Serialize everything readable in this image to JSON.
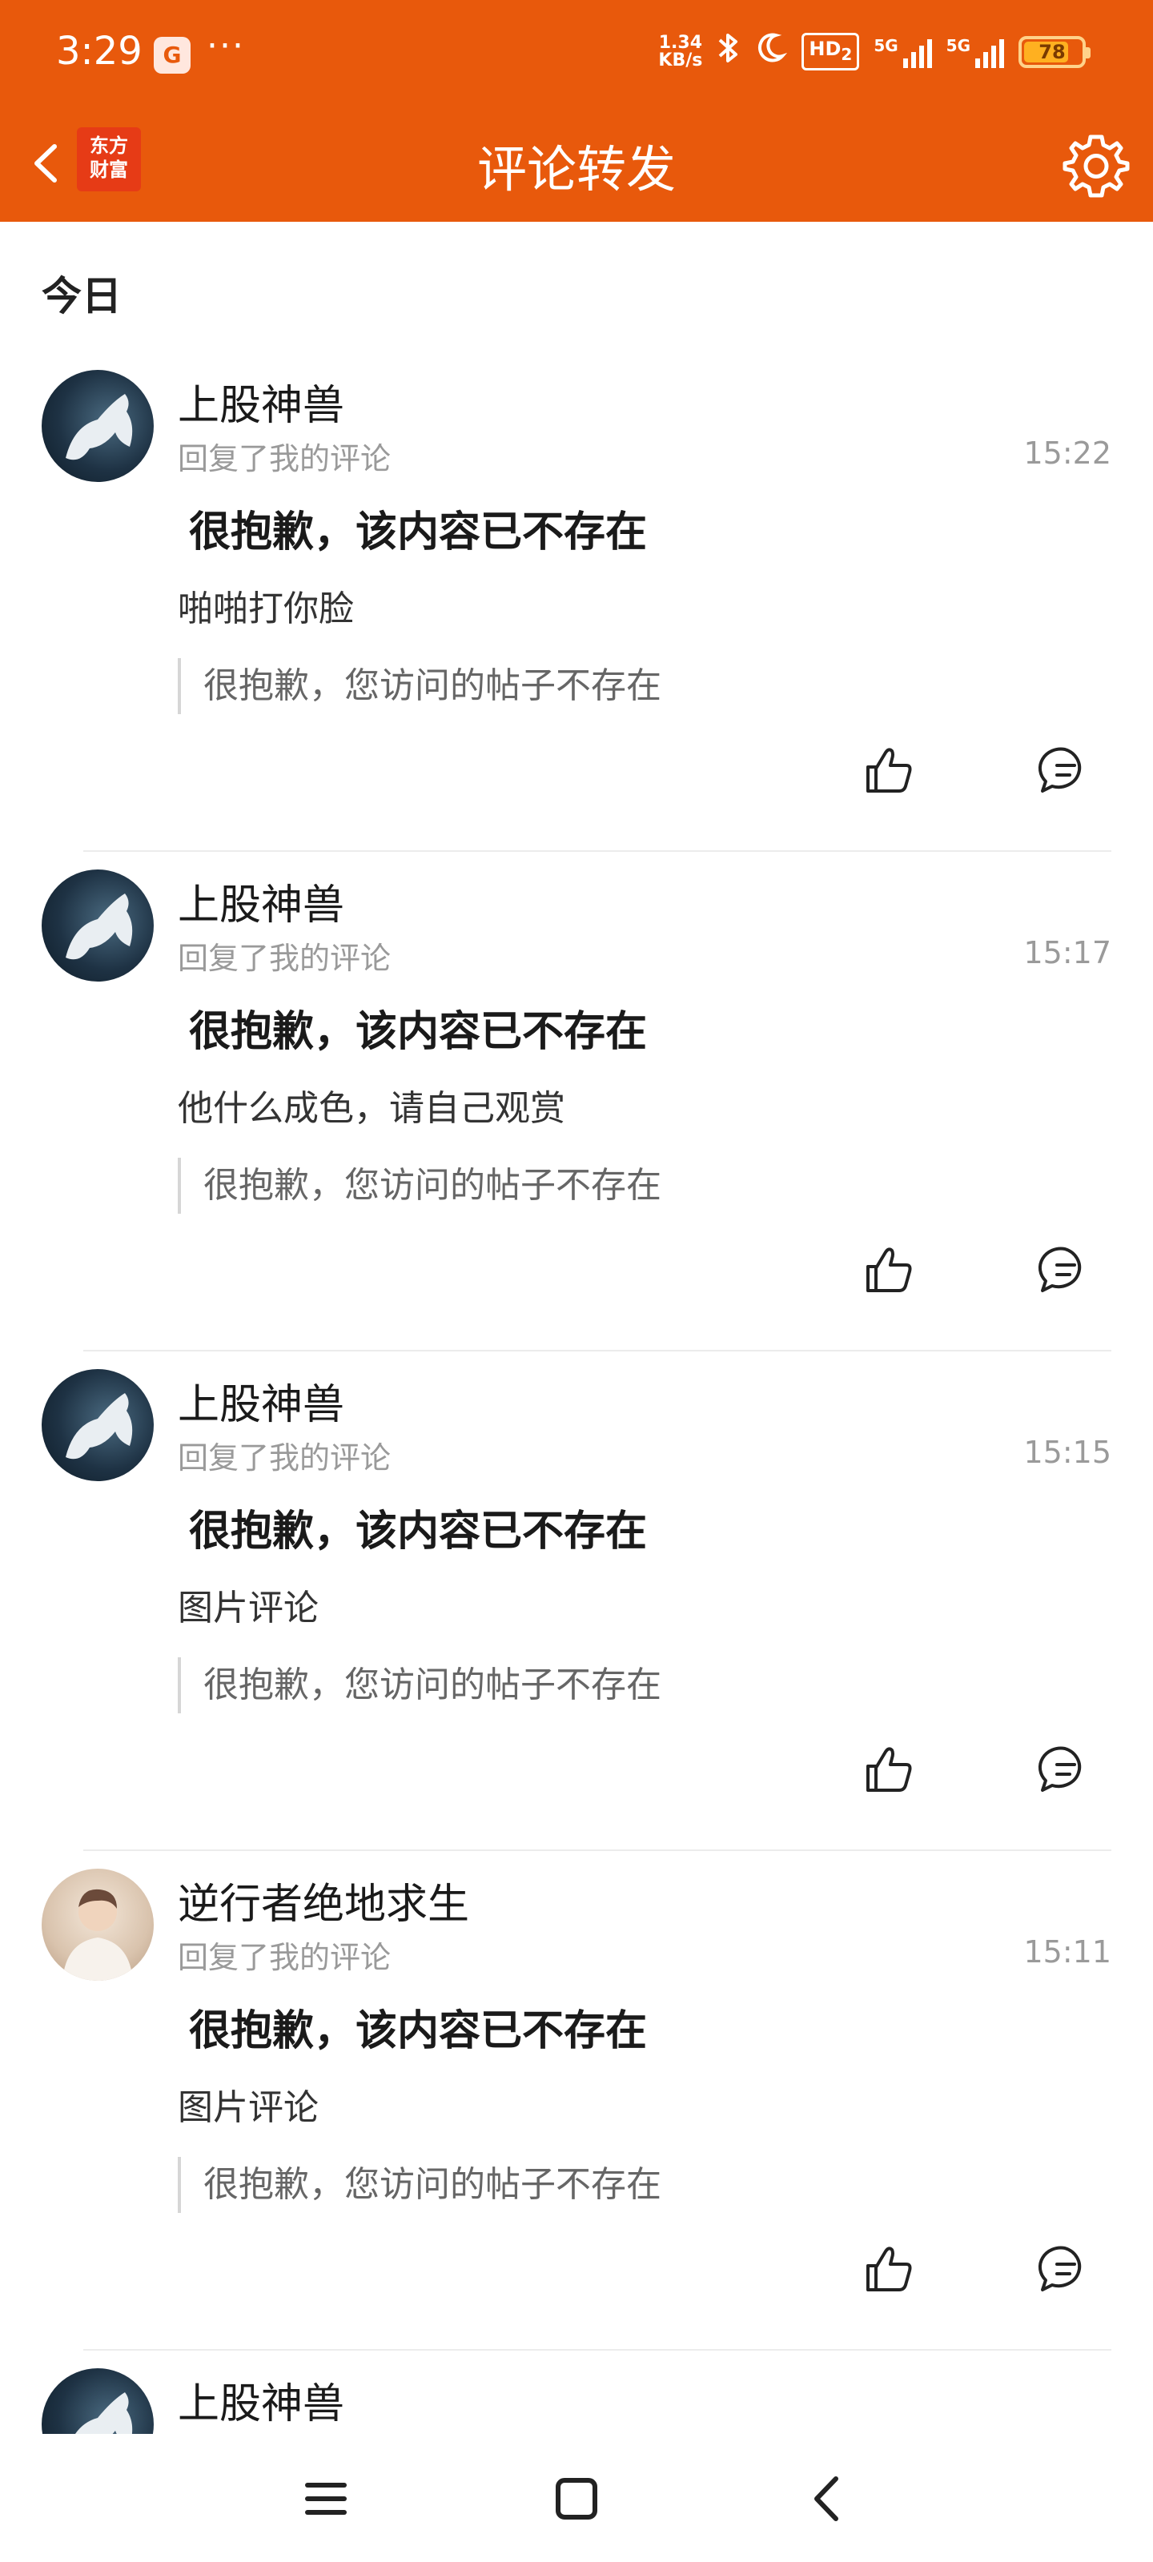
{
  "status_bar": {
    "time": "3:29",
    "app_badge": "G",
    "dots": "···",
    "speed_value": "1.34",
    "speed_unit": "KB/s",
    "hd": "HD",
    "hd_sub": "2",
    "sig1_label": "5G",
    "sig2_label": "5G",
    "battery": "78",
    "battery_level": 0.78
  },
  "header": {
    "title": "评论转发",
    "brand_line1": "东方",
    "brand_line2": "财富"
  },
  "section_date": "今日",
  "items": [
    {
      "username": "上股神兽",
      "subtext": "回复了我的评论",
      "time": "15:22",
      "main": "很抱歉，该内容已不存在",
      "reply": "啪啪打你脸",
      "quote": "很抱歉，您访问的帖子不存在"
    },
    {
      "username": "上股神兽",
      "subtext": "回复了我的评论",
      "time": "15:17",
      "main": "很抱歉，该内容已不存在",
      "reply": "他什么成色，请自己观赏",
      "quote": "很抱歉，您访问的帖子不存在"
    },
    {
      "username": "上股神兽",
      "subtext": "回复了我的评论",
      "time": "15:15",
      "main": "很抱歉，该内容已不存在",
      "reply": "图片评论",
      "quote": "很抱歉，您访问的帖子不存在"
    },
    {
      "username": "逆行者绝地求生",
      "subtext": "回复了我的评论",
      "time": "15:11",
      "main": "很抱歉，该内容已不存在",
      "reply": "图片评论",
      "quote": "很抱歉，您访问的帖子不存在"
    },
    {
      "username": "上股神兽"
    }
  ],
  "colors": {
    "brand_orange": "#e8590c",
    "logo_red": "#e63b16",
    "muted_text": "#9a9a9a"
  },
  "icons": {
    "back": "chevron-left-icon",
    "settings": "gear-icon",
    "like": "thumbs-up-icon",
    "comment": "comment-bubble-icon",
    "nav_menu": "menu-icon",
    "nav_home": "square-icon",
    "nav_back": "back-arrow-icon"
  }
}
